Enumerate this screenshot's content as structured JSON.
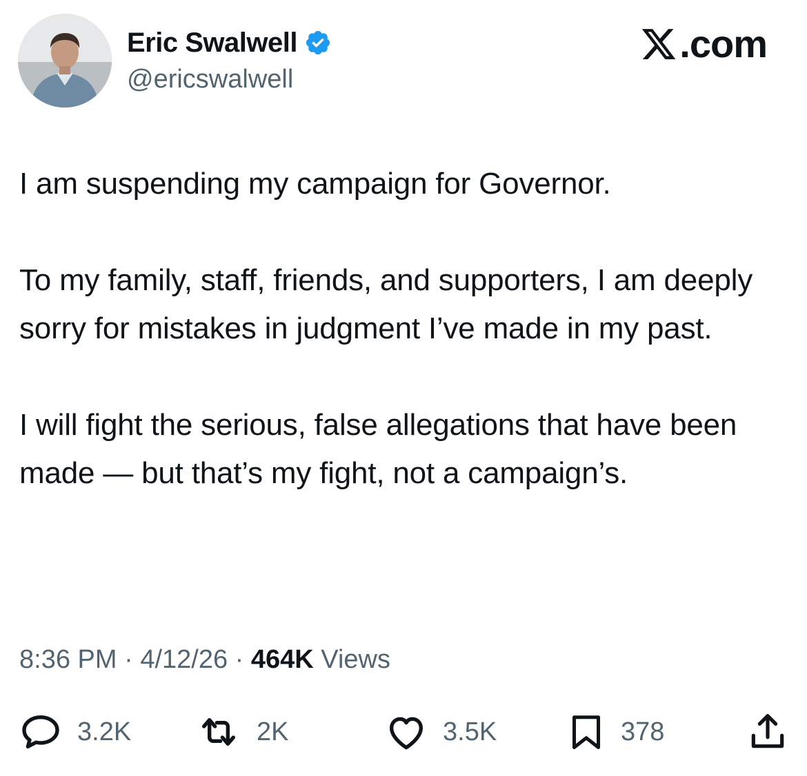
{
  "author": {
    "display_name": "Eric Swalwell",
    "handle": "@ericswalwell",
    "verified": true,
    "verified_color": "#1d9bf0"
  },
  "brand": {
    "label": ".com"
  },
  "tweet": {
    "paragraphs": [
      "I am suspending my campaign for Governor.",
      "To my family, staff, friends, and supporters, I am deeply sorry for mistakes in judgment I’ve made in my past.",
      "I will fight the serious, false allegations that have been made — but that’s my fight, not a campaign’s."
    ]
  },
  "meta": {
    "time": "8:36 PM",
    "separator": "·",
    "date": "4/12/26",
    "views_count": "464K",
    "views_label": "Views"
  },
  "actions": {
    "replies": "3.2K",
    "reposts": "2K",
    "likes": "3.5K",
    "bookmarks": "378"
  },
  "icons": {
    "reply": "reply-icon",
    "repost": "repost-icon",
    "like": "heart-icon",
    "bookmark": "bookmark-icon",
    "share": "share-icon"
  },
  "colors": {
    "text_primary": "#0f1419",
    "text_secondary": "#536471",
    "accent": "#1d9bf0"
  }
}
